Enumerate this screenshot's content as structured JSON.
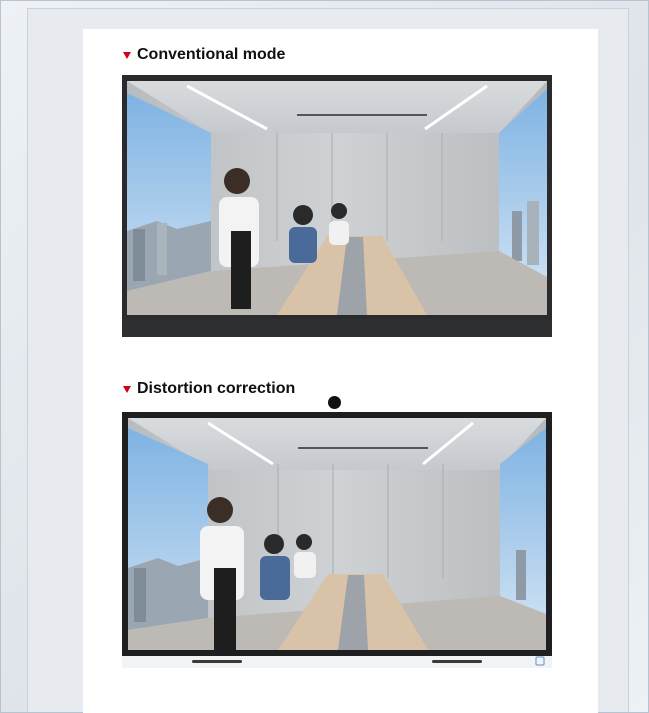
{
  "section1": {
    "heading": "Conventional mode"
  },
  "section2": {
    "heading": "Distortion correction"
  }
}
